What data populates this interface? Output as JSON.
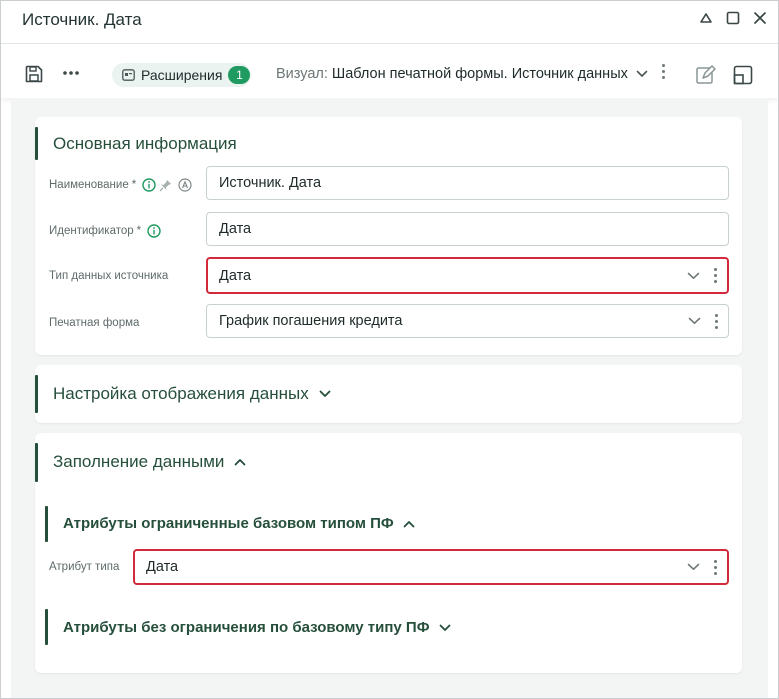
{
  "window": {
    "title": "Источник. Дата"
  },
  "toolbar": {
    "more_label": "•••",
    "extensions_label": "Расширения",
    "extensions_count": "1",
    "visual_key": "Визуал:",
    "visual_value": "Шаблон печатной формы. Источник данных"
  },
  "main_info": {
    "title": "Основная информация",
    "name_label": "Наименование",
    "required_mark": "*",
    "name_value": "Источник. Дата",
    "id_label": "Идентификатор",
    "id_value": "Дата",
    "source_type_label": "Тип данных источника",
    "source_type_value": "Дата",
    "print_form_label": "Печатная форма",
    "print_form_value": "График погашения кредита"
  },
  "display_settings": {
    "title": "Настройка отображения данных"
  },
  "data_fill": {
    "title": "Заполнение данными",
    "restricted_title": "Атрибуты ограниченные базовом типом ПФ",
    "attr_type_label": "Атрибут типа",
    "attr_type_value": "Дата",
    "unrestricted_title": "Атрибуты без ограничения по базовому типу ПФ"
  },
  "colors": {
    "accent": "#264f3b",
    "badge": "#1f9a60",
    "highlight": "#d22a3a",
    "info_icon": "#1f9a60"
  },
  "icons": [
    "expand-icon",
    "restore-icon",
    "close-icon",
    "save-icon",
    "more-icon",
    "extensions-icon",
    "chevron-down-icon",
    "kebab-icon",
    "edit-icon",
    "layout-icon",
    "info-icon",
    "pin-icon",
    "auto-letter-icon",
    "chevron-up-icon"
  ]
}
